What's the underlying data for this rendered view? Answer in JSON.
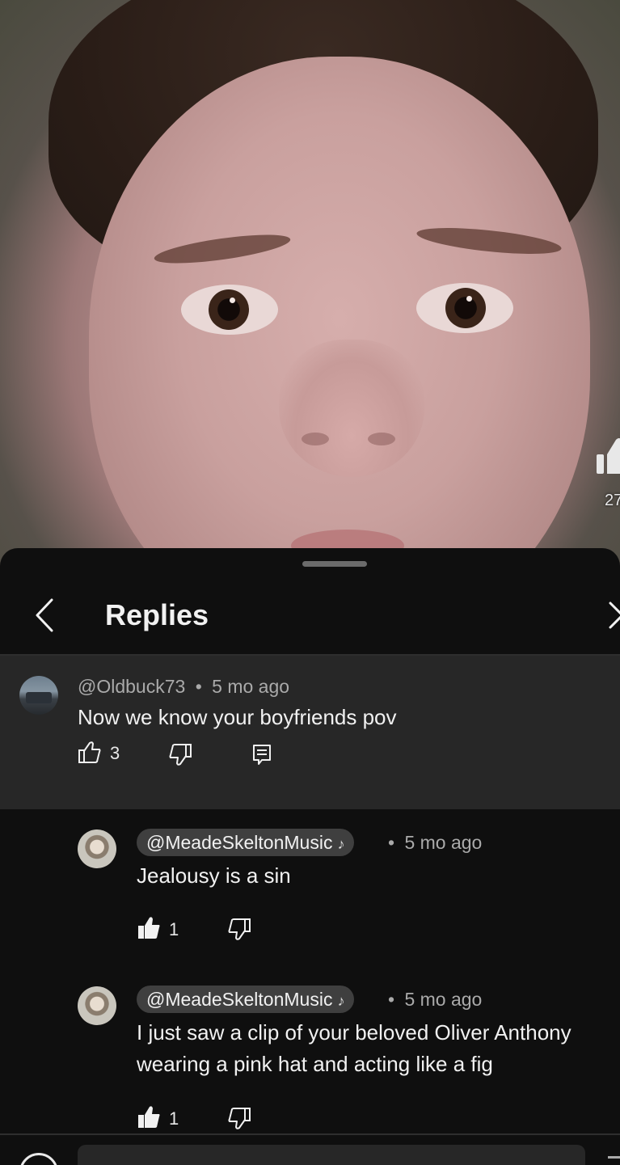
{
  "video": {
    "side_like_count": "27"
  },
  "sheet": {
    "title": "Replies"
  },
  "parent_comment": {
    "author": "@Oldbuck73",
    "separator": "•",
    "time": "5 mo ago",
    "text": "Now we know your boyfriends pov",
    "likes": "3"
  },
  "replies": [
    {
      "author": "@MeadeSkeltonMusic",
      "separator": "•",
      "time": "5 mo ago",
      "text": "Jealousy is a sin",
      "likes": "1",
      "liked": true
    },
    {
      "author": "@MeadeSkeltonMusic",
      "separator": "•",
      "time": "5 mo ago",
      "text": "I just saw a clip of your beloved Oliver Anthony wearing a pink hat and acting like a fig",
      "likes": "1",
      "liked": true
    }
  ],
  "reply_box": {
    "placeholder": ""
  },
  "colors": {
    "sheet_bg": "#0f0f0f",
    "highlight_bg": "#272727",
    "chip_bg": "#3f3f3f",
    "meta_text": "#aaaaaa",
    "primary_text": "#f1f1f1"
  },
  "icons": [
    "back-arrow-icon",
    "close-icon",
    "thumbs-up-icon",
    "thumbs-down-icon",
    "reply-icon",
    "music-note-icon"
  ]
}
